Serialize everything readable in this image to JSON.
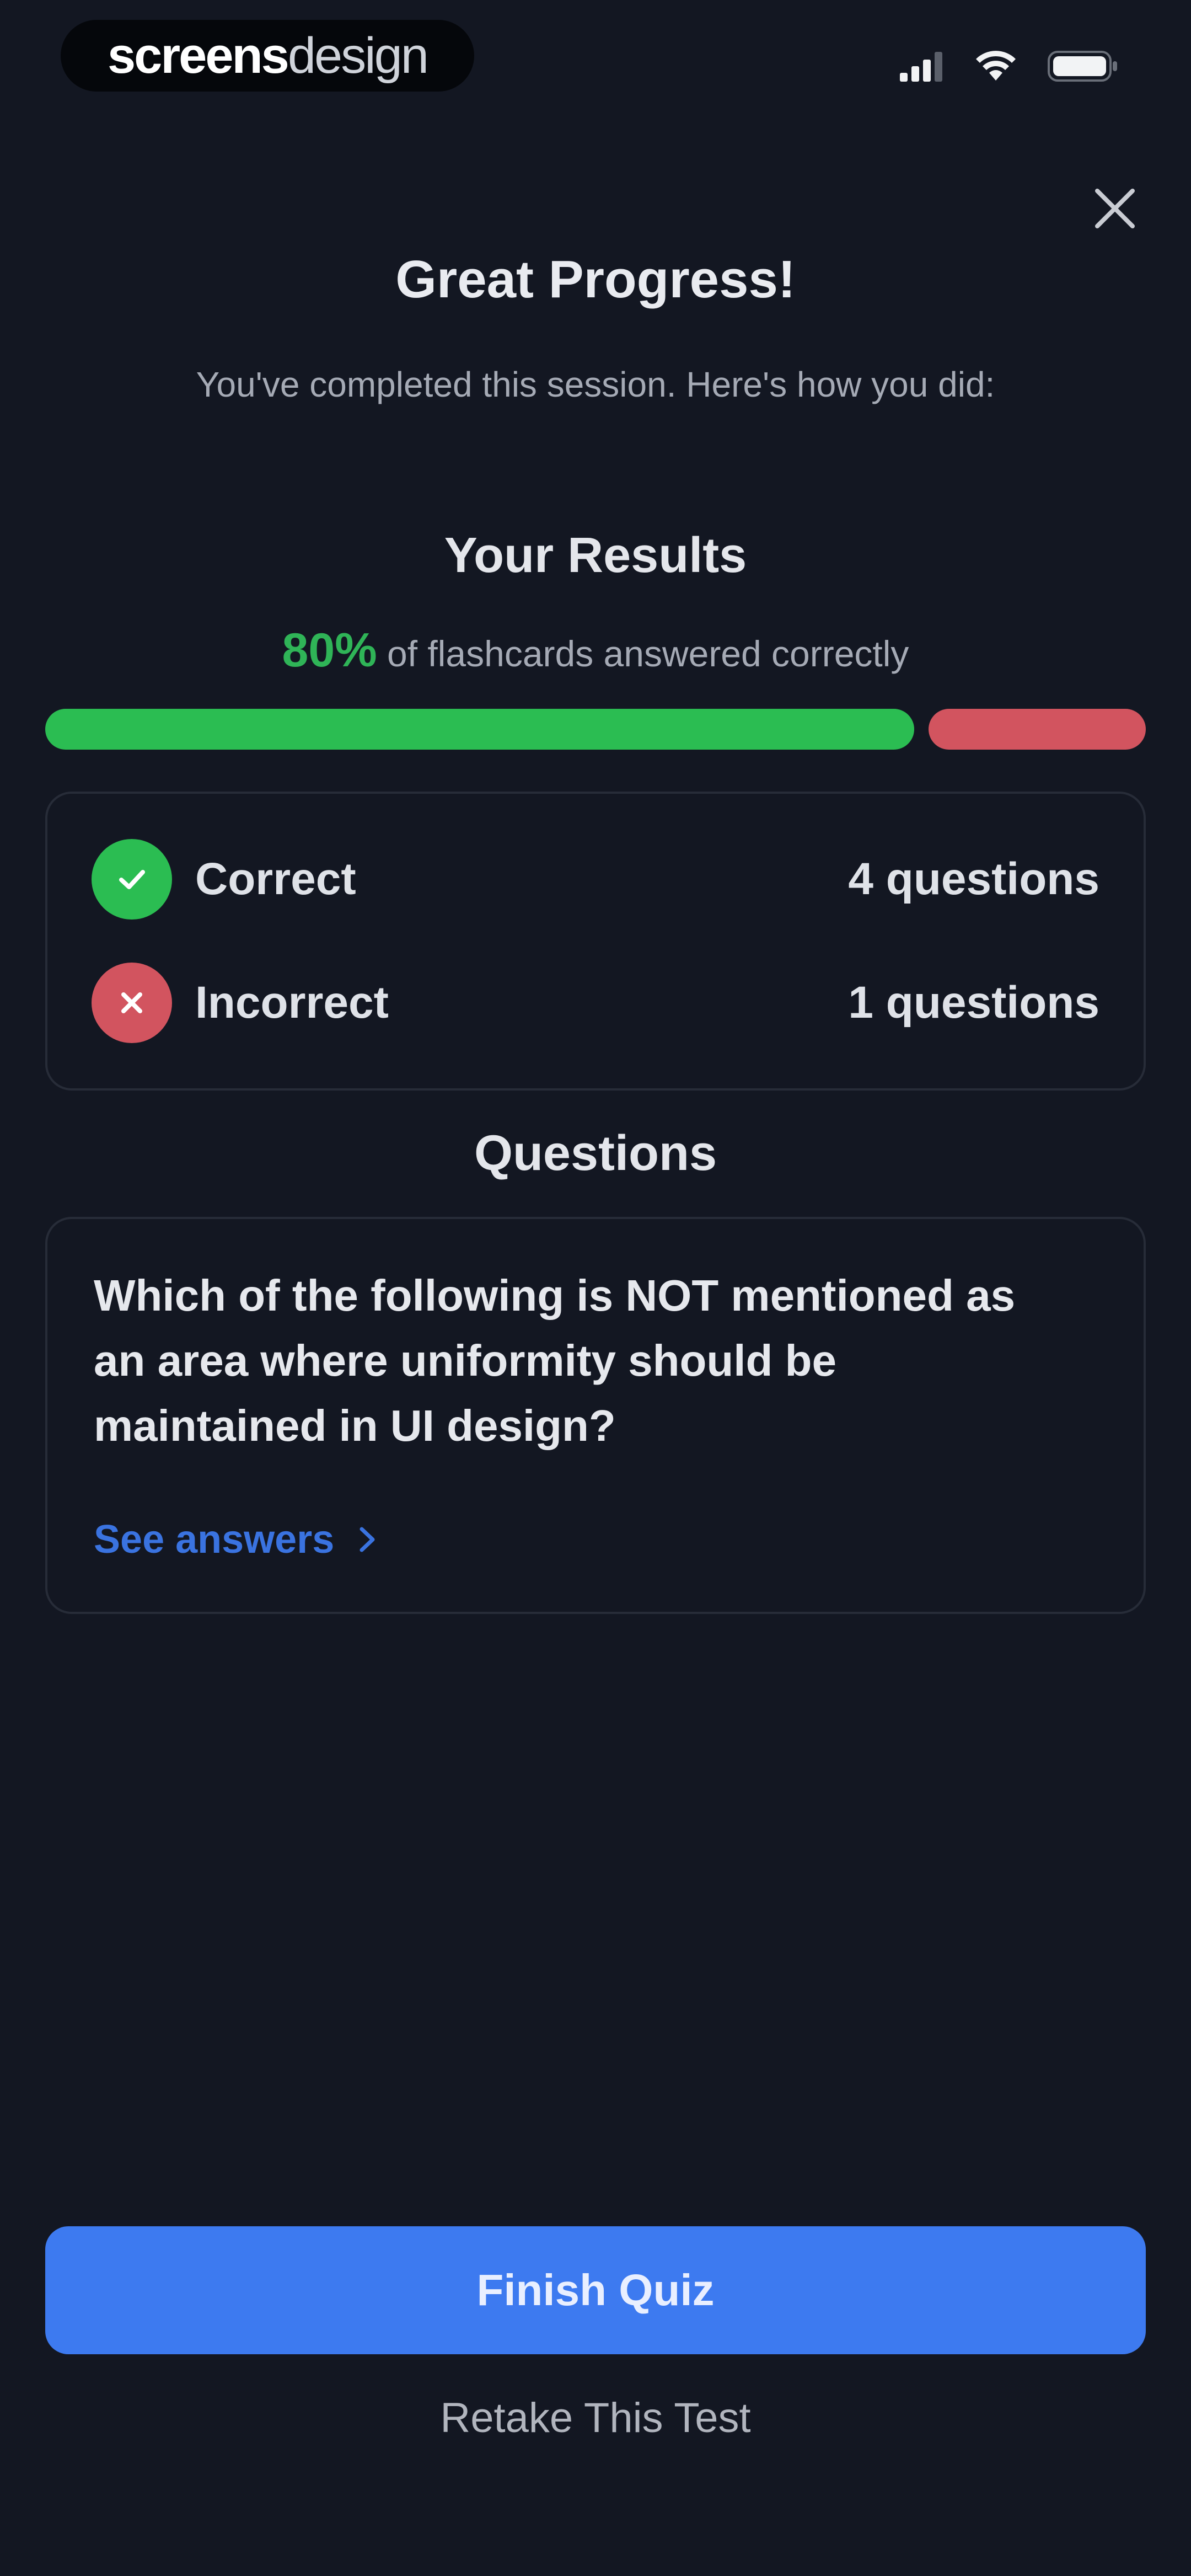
{
  "brand": {
    "part_bold": "screens",
    "part_thin": "design"
  },
  "status_bar": {
    "icons": [
      "signal-icon",
      "wifi-icon",
      "battery-icon"
    ]
  },
  "header": {
    "close_icon": "close-icon",
    "title": "Great Progress!",
    "subtitle": "You've completed this session. Here's how you did:"
  },
  "results": {
    "heading": "Your Results",
    "percent_text": "80%",
    "percent_suffix": "of flashcards answered correctly",
    "correct_fraction": 0.8,
    "colors": {
      "correct": "#2bbd52",
      "incorrect": "#d2545f"
    }
  },
  "summary": {
    "rows": [
      {
        "label": "Correct",
        "count": "4 questions",
        "icon": "check-icon",
        "color": "#2bbd52"
      },
      {
        "label": "Incorrect",
        "count": "1 questions",
        "icon": "x-icon",
        "color": "#d2545f"
      }
    ]
  },
  "questions": {
    "heading": "Questions",
    "items": [
      {
        "text": "Which of the following is NOT mentioned as an area where uniformity should be maintained in UI design?",
        "link_label": "See answers",
        "link_icon": "chevron-right-icon"
      }
    ]
  },
  "actions": {
    "finish_label": "Finish Quiz",
    "finish_color": "#3d7af0",
    "retake_label": "Retake This Test"
  }
}
